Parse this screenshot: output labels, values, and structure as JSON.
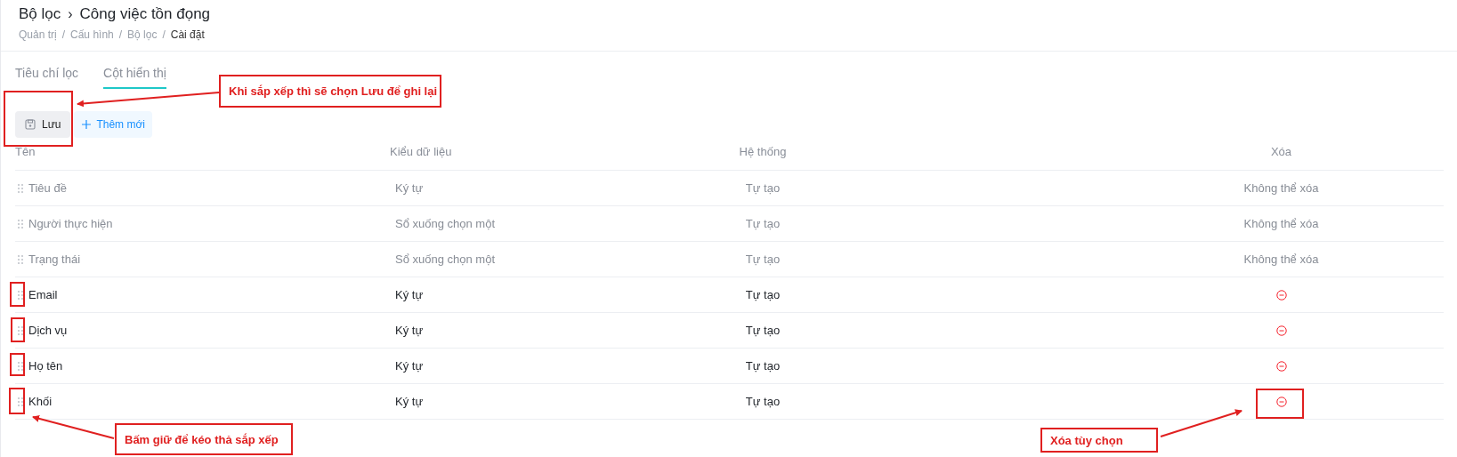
{
  "header": {
    "title_parts": [
      "Bộ lọc",
      "Công việc tồn đọng"
    ],
    "separator": "›"
  },
  "breadcrumb": [
    {
      "label": "Quản trị",
      "current": false
    },
    {
      "label": "Cấu hình",
      "current": false
    },
    {
      "label": "Bộ lọc",
      "current": false
    },
    {
      "label": "Cài đặt",
      "current": true
    }
  ],
  "breadcrumb_separator": "/",
  "tabs": [
    {
      "label": "Tiêu chí lọc",
      "selected": false
    },
    {
      "label": "Cột hiển thị",
      "selected": true
    }
  ],
  "toolbar": {
    "save_label": "Lưu",
    "add_label": "Thêm mới"
  },
  "table": {
    "columns": [
      "Tên",
      "Kiểu dữ liệu",
      "Hệ thống",
      "Xóa"
    ],
    "rows": [
      {
        "name": "Tiêu đề",
        "type": "Ký tự",
        "system": "Tự tạo",
        "locked": true,
        "delete_label": "Không thể xóa"
      },
      {
        "name": "Người thực hiện",
        "type": "Sổ xuống chọn một",
        "system": "Tự tạo",
        "locked": true,
        "delete_label": "Không thể xóa"
      },
      {
        "name": "Trạng thái",
        "type": "Sổ xuống chọn một",
        "system": "Tự tạo",
        "locked": true,
        "delete_label": "Không thể xóa"
      },
      {
        "name": "Email",
        "type": "Ký tự",
        "system": "Tự tạo",
        "locked": false
      },
      {
        "name": "Dịch vụ",
        "type": "Ký tự",
        "system": "Tự tạo",
        "locked": false
      },
      {
        "name": "Họ tên",
        "type": "Ký tự",
        "system": "Tự tạo",
        "locked": false
      },
      {
        "name": "Khối",
        "type": "Ký tự",
        "system": "Tự tạo",
        "locked": false
      }
    ]
  },
  "annotations": [
    {
      "text": "Khi sắp xếp thì sẽ chọn Lưu để ghi lại"
    },
    {
      "text": "Bấm giữ để kéo thả sắp xếp"
    },
    {
      "text": "Xóa tùy chọn"
    }
  ]
}
